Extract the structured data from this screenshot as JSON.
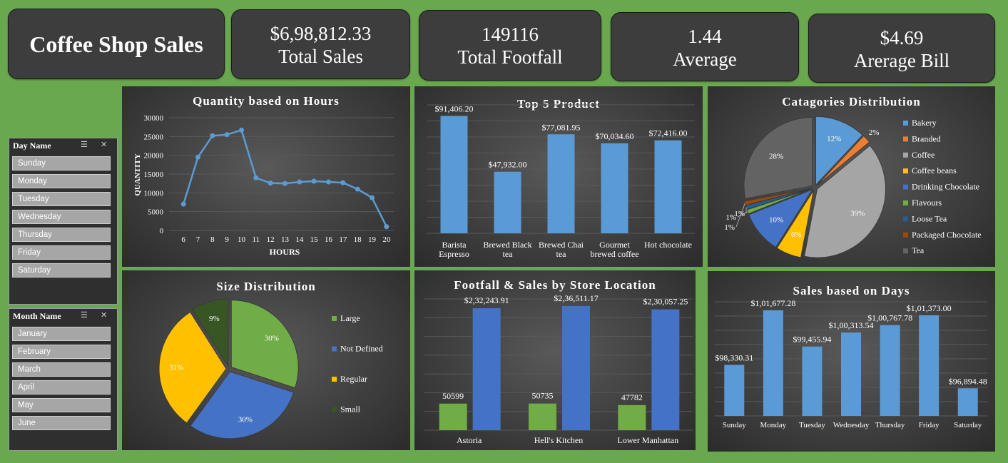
{
  "header": {
    "title": "Coffee Shop Sales",
    "kpis": [
      {
        "value": "$6,98,812.33",
        "label": "Total Sales"
      },
      {
        "value": "149116",
        "label": "Total Footfall"
      },
      {
        "value": "1.44",
        "label": "Average"
      },
      {
        "value": "$4.69",
        "label": "Arerage Bill"
      }
    ]
  },
  "slicers": {
    "day": {
      "title": "Day Name",
      "items": [
        "Sunday",
        "Monday",
        "Tuesday",
        "Wednesday",
        "Thursday",
        "Friday",
        "Saturday"
      ]
    },
    "month": {
      "title": "Month Name",
      "items": [
        "January",
        "February",
        "March",
        "April",
        "May",
        "June"
      ]
    }
  },
  "colors": {
    "background": "#6aa84f",
    "blue": "#5b9bd5",
    "green": "#70ad47",
    "orange": "#ed7d31",
    "gray": "#a5a5a5",
    "gold": "#ffc000",
    "royal": "#4472c4"
  },
  "chart_data": [
    {
      "id": "hours",
      "type": "line",
      "title": "Quantity based on Hours",
      "xlabel": "HOURS",
      "ylabel": "QUANTITY",
      "x": [
        6,
        7,
        8,
        9,
        10,
        11,
        12,
        13,
        14,
        15,
        16,
        17,
        18,
        19,
        20
      ],
      "values": [
        7000,
        19500,
        25200,
        25500,
        26700,
        14000,
        12600,
        12500,
        12900,
        13100,
        12900,
        12700,
        11000,
        8700,
        1000
      ],
      "yticks": [
        "30000",
        "25000",
        "20000",
        "15000",
        "10000",
        "5000",
        "0"
      ],
      "ylim": [
        0,
        30000
      ],
      "grid": true
    },
    {
      "id": "products",
      "type": "bar",
      "title": "Top 5 Product",
      "categories": [
        [
          "Barista",
          "Espresso"
        ],
        [
          "Brewed Black",
          "tea"
        ],
        [
          "Brewed Chai",
          "tea"
        ],
        [
          "Gourmet",
          "brewed coffee"
        ],
        [
          "Hot chocolate"
        ]
      ],
      "values": [
        91406.2,
        47932.0,
        77081.95,
        70034.6,
        72416.0
      ],
      "labels": [
        "$91,406.20",
        "$47,932.00",
        "$77,081.95",
        "$70,034.60",
        "$72,416.00"
      ],
      "ylim": [
        0,
        100000
      ],
      "grid": true
    },
    {
      "id": "categories",
      "type": "pie",
      "title": "Catagories Distribution",
      "categories": [
        "Bakery",
        "Branded",
        "Coffee",
        "Coffee beans",
        "Drinking Chocolate",
        "Flavours",
        "Loose Tea",
        "Packaged Chocolate",
        "Tea"
      ],
      "values": [
        12,
        2,
        39,
        6,
        10,
        1,
        1,
        1,
        28
      ],
      "labels": [
        "12%",
        "2%",
        "39%",
        "6%",
        "10%",
        "1%",
        "1%",
        "1%",
        "28%"
      ],
      "colors": [
        "#5b9bd5",
        "#ed7d31",
        "#a5a5a5",
        "#ffc000",
        "#4472c4",
        "#70ad47",
        "#255e91",
        "#9e480e",
        "#636363"
      ],
      "legend": "right"
    },
    {
      "id": "size",
      "type": "pie",
      "title": "Size Distribution",
      "categories": [
        "Large",
        "Not Defined",
        "Regular",
        "Small"
      ],
      "values": [
        30,
        30,
        31,
        9
      ],
      "labels": [
        "30%",
        "30%",
        "31%",
        "9%"
      ],
      "colors": [
        "#70ad47",
        "#4472c4",
        "#ffc000",
        "#375623"
      ],
      "legend": "right"
    },
    {
      "id": "location",
      "type": "bar",
      "title": "Footfall & Sales by Store Location",
      "categories": [
        "Astoria",
        "Hell's Kitchen",
        "Lower Manhattan"
      ],
      "series": [
        {
          "values": [
            50599,
            50735,
            47782
          ],
          "labels": [
            "50599",
            "50735",
            "47782"
          ],
          "color": "#70ad47"
        },
        {
          "values": [
            232243.91,
            236511.17,
            230057.25
          ],
          "labels": [
            "$2,32,243.91",
            "$2,36,511.17",
            "$2,30,057.25"
          ],
          "color": "#4472c4"
        }
      ],
      "ylim": [
        0,
        250000
      ],
      "grid": true
    },
    {
      "id": "days",
      "type": "bar",
      "title": "Sales based on Days",
      "categories": [
        "Sunday",
        "Monday",
        "Tuesday",
        "Wednesday",
        "Thursday",
        "Friday",
        "Saturday"
      ],
      "values": [
        98330.31,
        101677.28,
        99455.94,
        100313.54,
        100767.78,
        101373.0,
        96894.48
      ],
      "labels": [
        "$98,330.31",
        "$1,01,677.28",
        "$99,455.94",
        "$1,00,313.54",
        "$1,00,767.78",
        "$1,01,373.00",
        "$96,894.48"
      ],
      "ylim": [
        95200,
        102200
      ],
      "grid": true
    }
  ]
}
